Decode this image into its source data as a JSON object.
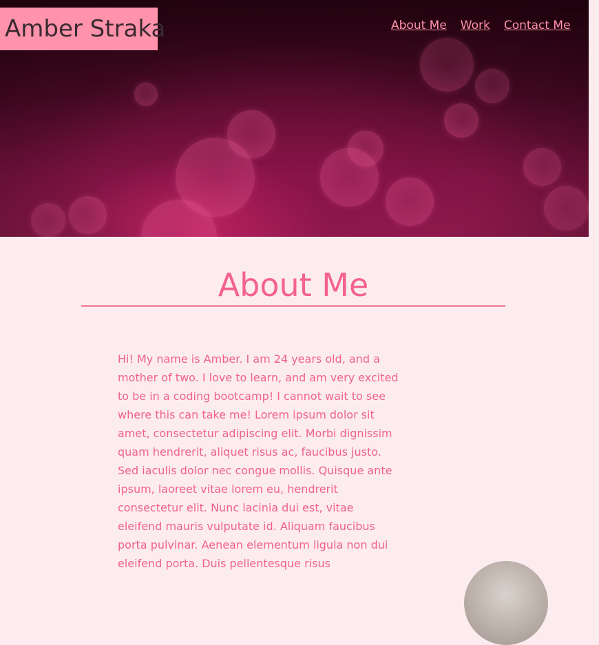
{
  "header": {
    "site_name": "Amber Straka",
    "nav": [
      {
        "label": "About Me"
      },
      {
        "label": "Work"
      },
      {
        "label": "Contact Me"
      }
    ]
  },
  "about": {
    "title": "About Me",
    "bio": "Hi! My name is Amber. I am 24 years old, and a mother of two. I love to learn, and am very excited to be in a coding bootcamp! I cannot wait to see where this can take me! Lorem ipsum dolor sit amet, consectetur adipiscing elit. Morbi dignissim quam hendrerit, aliquet risus ac, faucibus justo. Sed iaculis dolor nec congue mollis. Quisque ante ipsum, laoreet vitae lorem eu, hendrerit consectetur elit. Nunc lacinia dui est, vitae eleifend mauris vulputate id. Aliquam faucibus porta pulvinar. Aenean elementum ligula non dui eleifend porta. Duis pellentesque risus"
  },
  "colors": {
    "page_background": "#fdecef",
    "accent_pink": "#ff93ac",
    "heading_pink": "#f4628e",
    "body_text_pink": "#f0628c",
    "logo_text": "#3a2a30"
  }
}
